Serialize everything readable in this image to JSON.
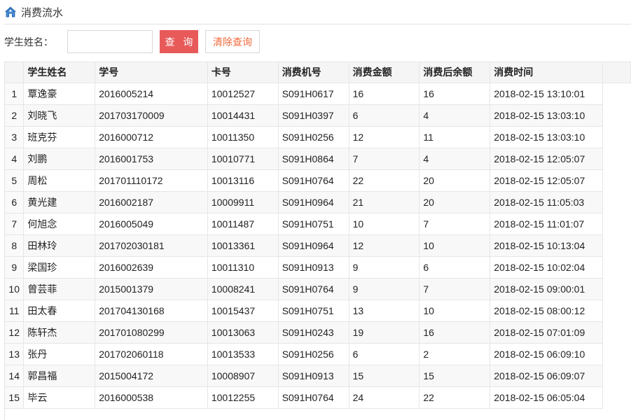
{
  "page": {
    "title": "消费流水",
    "title_icon": "home-icon",
    "accent_color": "#e85a5a"
  },
  "search": {
    "label": "学生姓名：",
    "input_value": "",
    "input_placeholder": "",
    "query_button": "查 询",
    "clear_button": "清除查询"
  },
  "table": {
    "columns": [
      "学生姓名",
      "学号",
      "卡号",
      "消费机号",
      "消费金额",
      "消费后余额",
      "消费时间"
    ],
    "rows": [
      {
        "n": "1",
        "name": "覃逸豪",
        "sid": "2016005214",
        "card": "10012527",
        "machine": "S091H0617",
        "amount": "16",
        "balance": "16",
        "time": "2018-02-15 13:10:01"
      },
      {
        "n": "2",
        "name": "刘晓飞",
        "sid": "201703170009",
        "card": "10014431",
        "machine": "S091H0397",
        "amount": "6",
        "balance": "4",
        "time": "2018-02-15 13:03:10"
      },
      {
        "n": "3",
        "name": "班克芬",
        "sid": "2016000712",
        "card": "10011350",
        "machine": "S091H0256",
        "amount": "12",
        "balance": "11",
        "time": "2018-02-15 13:03:10"
      },
      {
        "n": "4",
        "name": "刘鹏",
        "sid": "2016001753",
        "card": "10010771",
        "machine": "S091H0864",
        "amount": "7",
        "balance": "4",
        "time": "2018-02-15 12:05:07"
      },
      {
        "n": "5",
        "name": "周松",
        "sid": "201701110172",
        "card": "10013116",
        "machine": "S091H0764",
        "amount": "22",
        "balance": "20",
        "time": "2018-02-15 12:05:07"
      },
      {
        "n": "6",
        "name": "黄光建",
        "sid": "2016002187",
        "card": "10009911",
        "machine": "S091H0964",
        "amount": "21",
        "balance": "20",
        "time": "2018-02-15 11:05:03"
      },
      {
        "n": "7",
        "name": "何旭念",
        "sid": "2016005049",
        "card": "10011487",
        "machine": "S091H0751",
        "amount": "10",
        "balance": "7",
        "time": "2018-02-15 11:01:07"
      },
      {
        "n": "8",
        "name": "田林玲",
        "sid": "201702030181",
        "card": "10013361",
        "machine": "S091H0964",
        "amount": "12",
        "balance": "10",
        "time": "2018-02-15 10:13:04"
      },
      {
        "n": "9",
        "name": "梁国珍",
        "sid": "2016002639",
        "card": "10011310",
        "machine": "S091H0913",
        "amount": "9",
        "balance": "6",
        "time": "2018-02-15 10:02:04"
      },
      {
        "n": "10",
        "name": "曾芸菲",
        "sid": "2015001379",
        "card": "10008241",
        "machine": "S091H0764",
        "amount": "9",
        "balance": "7",
        "time": "2018-02-15 09:00:01"
      },
      {
        "n": "11",
        "name": "田太春",
        "sid": "201704130168",
        "card": "10015437",
        "machine": "S091H0751",
        "amount": "13",
        "balance": "10",
        "time": "2018-02-15 08:00:12"
      },
      {
        "n": "12",
        "name": "陈轩杰",
        "sid": "201701080299",
        "card": "10013063",
        "machine": "S091H0243",
        "amount": "19",
        "balance": "16",
        "time": "2018-02-15 07:01:09"
      },
      {
        "n": "13",
        "name": "张丹",
        "sid": "201702060118",
        "card": "10013533",
        "machine": "S091H0256",
        "amount": "6",
        "balance": "2",
        "time": "2018-02-15 06:09:10"
      },
      {
        "n": "14",
        "name": "郭昌福",
        "sid": "2015004172",
        "card": "10008907",
        "machine": "S091H0913",
        "amount": "15",
        "balance": "15",
        "time": "2018-02-15 06:09:07"
      },
      {
        "n": "15",
        "name": "毕云",
        "sid": "2016000538",
        "card": "10012255",
        "machine": "S091H0764",
        "amount": "24",
        "balance": "22",
        "time": "2018-02-15 06:05:04"
      }
    ]
  }
}
